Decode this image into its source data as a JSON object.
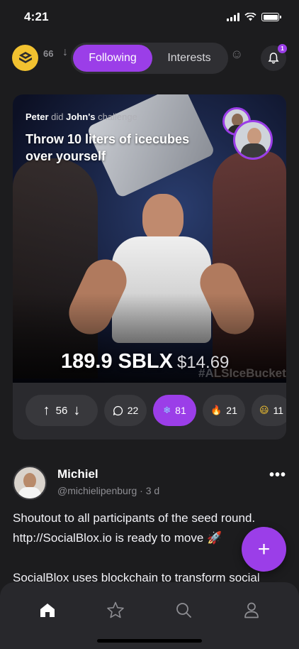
{
  "status_bar": {
    "time": "4:21"
  },
  "header": {
    "coin_count": "66",
    "tabs": [
      {
        "label": "Following",
        "active": true
      },
      {
        "label": "Interests",
        "active": false
      }
    ],
    "notification_badge": "1"
  },
  "card": {
    "actor": "Peter",
    "action": "did",
    "owner": "John's",
    "challenge_word": "challenge",
    "title": "Throw 10 liters of icecubes over yourself",
    "amount": "189.9 SBLX",
    "amount_usd": "$14.69",
    "watermark": "#ALSIceBucket",
    "reactions": {
      "vote_count": "56",
      "comments": "22",
      "snowflake": "81",
      "fire": "21",
      "smile": "11"
    }
  },
  "post": {
    "author": "Michiel",
    "handle": "@michielipenburg",
    "age": "· 3 d",
    "text_para1": "Shoutout to all participants of the seed round. http://SocialBlox.io is ready to move 🚀",
    "text_para2": "SocialBlox uses blockchain to transform social"
  },
  "fab_label": "+",
  "colors": {
    "accent": "#9b3ee8",
    "background": "#1c1c1e",
    "card": "#2a2a2e",
    "coin": "#f2c230"
  },
  "icons": {
    "nav": [
      "home-icon",
      "star-icon",
      "search-icon",
      "profile-icon"
    ]
  }
}
